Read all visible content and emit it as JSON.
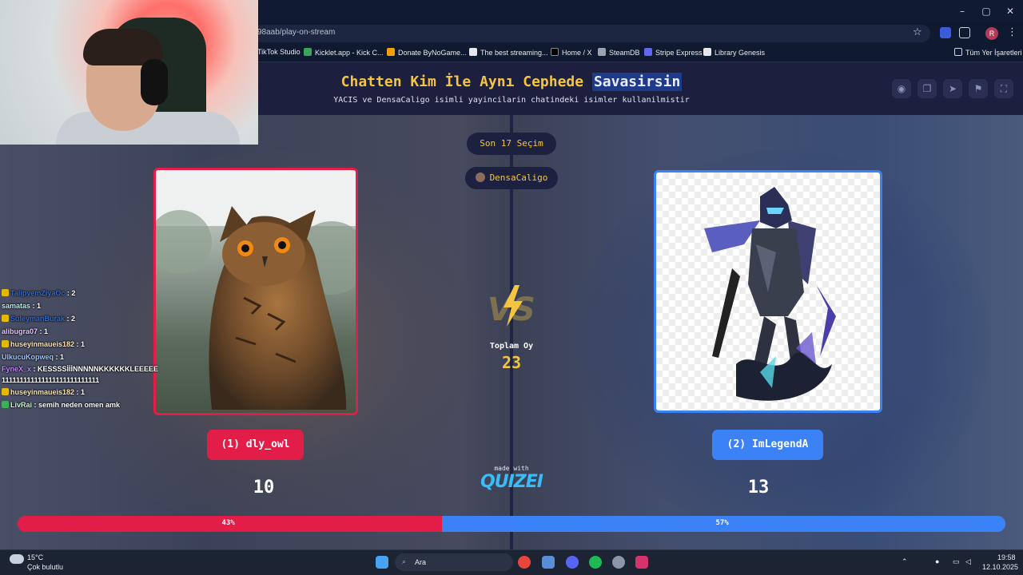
{
  "browser": {
    "url": "98aab/play-on-stream",
    "profile_initial": "R",
    "bookmarks": [
      {
        "label": "TikTok Studio",
        "color": "#111111"
      },
      {
        "label": "Kicklet.app - Kick C...",
        "color": "#3aa35b"
      },
      {
        "label": "Donate ByNoGame...",
        "color": "#f59e0b"
      },
      {
        "label": "The best streaming...",
        "color": "#e5e7eb"
      },
      {
        "label": "Home / X",
        "color": "#111111"
      },
      {
        "label": "SteamDB",
        "color": "#9ca3af"
      },
      {
        "label": "Stripe Express",
        "color": "#6366f1"
      },
      {
        "label": "Library Genesis",
        "color": "#e5e7eb"
      }
    ],
    "all_bookmarks_label": "Tüm Yer İşaretleri"
  },
  "header": {
    "title_main": "Chatten Kim İle Aynı Cephede ",
    "title_highlight": "Savasirsin",
    "subtitle": "YACIS ve DensaCaligo isimli yayincilarin chatindeki isimler kullanilmistir"
  },
  "pills": {
    "last_votes": "Son 17 Seçim",
    "streamer": "DensaCaligo"
  },
  "left": {
    "label": "(1) dly_owl",
    "score": "10",
    "percent": "43%",
    "color": "#e11d48",
    "share": 0.43
  },
  "right": {
    "label": "(2) ImLegendA",
    "score": "13",
    "percent": "57%",
    "color": "#3b82f6",
    "share": 0.57
  },
  "center": {
    "vs": "VS",
    "total_label": "Toplam Oy",
    "total": "23",
    "made_with": "made with",
    "logo": "QUIZEI"
  },
  "chat": [
    {
      "user": "TalipyemZiyaOc",
      "msg": " : 2",
      "color": "#2f6bd8",
      "badge": true
    },
    {
      "user": "samatas",
      "msg": " : 1",
      "color": "#b6f0e8",
      "badge": false
    },
    {
      "user": "SuleymanBurak",
      "msg": " : 2",
      "color": "#2f6bd8",
      "badge": true
    },
    {
      "user": "alibugra07",
      "msg": " : 1",
      "color": "#e8c6ff",
      "badge": false
    },
    {
      "user": "huseyinmaueis182",
      "msg": " : 1",
      "color": "#ffe6a8",
      "badge": true
    },
    {
      "user": "UlkucuKopweq",
      "msg": " : 1",
      "color": "#9ec5ff",
      "badge": false
    },
    {
      "user": "FyneX_x",
      "msg": " : KESSSSİİİNNNNNKKKKKKLEEEEE 111111111111111111111111111",
      "color": "#c084fc",
      "badge": false
    },
    {
      "user": "huseyinmaueis182",
      "msg": " : 1",
      "color": "#ffe6a8",
      "badge": true
    },
    {
      "user": "LivRai",
      "msg": " : semih neden omen amk",
      "color": "#c7f9cc",
      "badge": true
    }
  ],
  "taskbar": {
    "temp": "15°C",
    "weather": "Çok bulutlu",
    "search_placeholder": "Ara",
    "time": "19:58",
    "date": "12.10.2025"
  }
}
